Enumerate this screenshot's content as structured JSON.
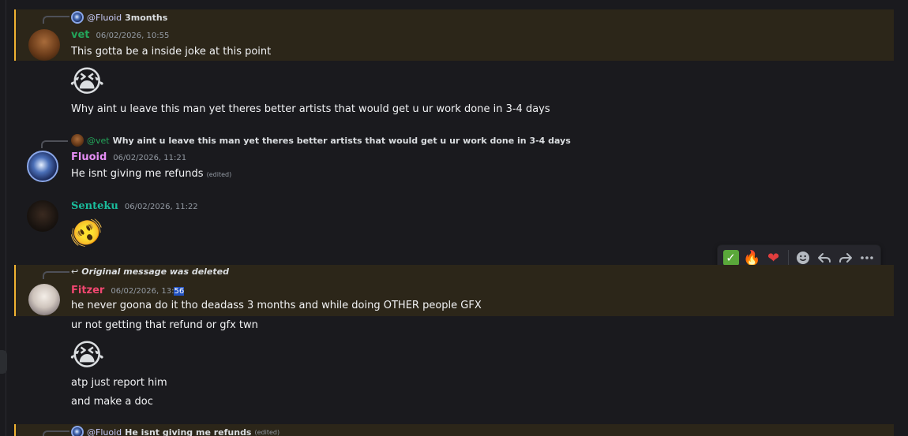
{
  "messages": [
    {
      "reply": {
        "mention": "@Fluoid",
        "text": "3months"
      },
      "author": "vet",
      "author_color": "#23a55a",
      "timestamp": "06/02/2026, 10:55",
      "lines": [
        "This gotta be a inside joke at this point"
      ],
      "followups": [
        {
          "emoji": "😭"
        },
        {
          "text": "Why aint u leave this man yet theres better artists that would get u ur work done in 3-4 days"
        }
      ]
    },
    {
      "reply": {
        "mention": "@vet",
        "text": "Why aint u leave this man yet theres better artists that would get u ur work done in 3-4 days"
      },
      "author": "Fluoid",
      "author_color": "#e58ef5",
      "timestamp": "06/02/2026, 11:21",
      "lines": [
        "He isnt giving me refunds"
      ],
      "edited": "(edited)"
    },
    {
      "author": "Senteku",
      "author_color": "#1abc9c",
      "timestamp": "06/02/2026, 11:22",
      "emoji": "🫨"
    },
    {
      "reply": {
        "text": "Original message was deleted"
      },
      "author": "Fitzer",
      "author_color": "#f04770",
      "timestamp_prefix": "06/02/2026, 13:",
      "timestamp_selected": "56",
      "lines": [
        "he never goona do it tho deadass 3 months and while doing OTHER people GFX"
      ],
      "followups": [
        {
          "text": "ur not getting that refund or gfx twn"
        },
        {
          "emoji": "😭"
        },
        {
          "text": "atp just report him"
        },
        {
          "text": "and make a doc"
        }
      ]
    },
    {
      "reply": {
        "mention": "@Fluoid",
        "text": "He isnt giving me refunds",
        "edited": "(edited)"
      }
    }
  ],
  "toolbar": {
    "reactions": [
      "✅",
      "🔥",
      "❤️"
    ],
    "actions": [
      "add-reaction",
      "reply",
      "forward",
      "more"
    ]
  }
}
